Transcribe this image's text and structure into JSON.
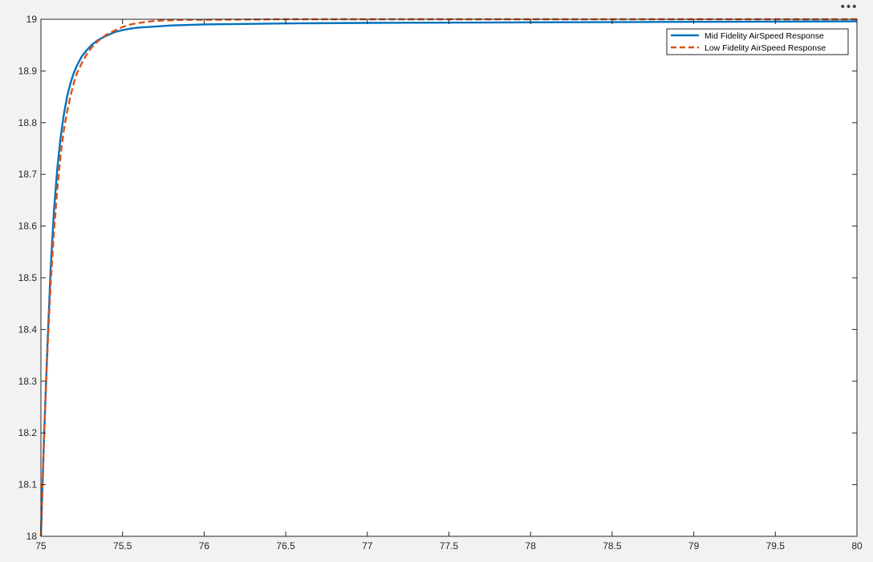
{
  "toolbar": {
    "more_icon": "ellipsis-icon",
    "more_glyph": "•••"
  },
  "colors": {
    "background": "#f2f2f2",
    "axes_background": "#ffffff",
    "axis": "#262626",
    "mid_series": "#0072bd",
    "low_series": "#d95319"
  },
  "chart_data": {
    "type": "line",
    "title": "",
    "xlabel": "",
    "ylabel": "",
    "xlim": [
      75,
      80
    ],
    "ylim": [
      18,
      19
    ],
    "xticks": [
      75,
      75.5,
      76,
      76.5,
      77,
      77.5,
      78,
      78.5,
      79,
      79.5,
      80
    ],
    "yticks": [
      18,
      18.1,
      18.2,
      18.3,
      18.4,
      18.5,
      18.6,
      18.7,
      18.8,
      18.9,
      19
    ],
    "xtick_labels": [
      "75",
      "75.5",
      "76",
      "76.5",
      "77",
      "77.5",
      "78",
      "78.5",
      "79",
      "79.5",
      "80"
    ],
    "ytick_labels": [
      "18",
      "18.1",
      "18.2",
      "18.3",
      "18.4",
      "18.5",
      "18.6",
      "18.7",
      "18.8",
      "18.9",
      "19"
    ],
    "grid": false,
    "legend_position": "top-right",
    "series": [
      {
        "name": "Mid Fidelity AirSpeed Response",
        "style": "solid",
        "color": "#0072bd",
        "x": [
          75,
          75.02,
          75.04,
          75.06,
          75.08,
          75.1,
          75.12,
          75.14,
          75.16,
          75.18,
          75.2,
          75.22,
          75.25,
          75.28,
          75.31,
          75.35,
          75.4,
          75.45,
          75.5,
          75.55,
          75.6,
          75.7,
          75.8,
          75.9,
          76,
          76.25,
          76.5,
          77,
          77.5,
          78,
          78.5,
          79,
          79.5,
          80
        ],
        "y": [
          18,
          18.2,
          18.37,
          18.52,
          18.63,
          18.71,
          18.77,
          18.815,
          18.85,
          18.875,
          18.895,
          18.91,
          18.928,
          18.94,
          18.95,
          18.96,
          18.968,
          18.975,
          18.979,
          18.982,
          18.984,
          18.986,
          18.988,
          18.989,
          18.99,
          18.991,
          18.992,
          18.993,
          18.9935,
          18.994,
          18.9945,
          18.995,
          18.9955,
          18.996
        ]
      },
      {
        "name": "Low Fidelity AirSpeed Response",
        "style": "dashed",
        "color": "#d95319",
        "x": [
          75,
          75.02,
          75.04,
          75.06,
          75.08,
          75.1,
          75.12,
          75.14,
          75.16,
          75.18,
          75.2,
          75.22,
          75.25,
          75.28,
          75.31,
          75.35,
          75.4,
          75.45,
          75.5,
          75.55,
          75.6,
          75.65,
          75.7,
          75.8,
          75.9,
          76,
          76.5,
          77,
          77.5,
          78,
          78.5,
          79,
          79.5,
          80
        ],
        "y": [
          18,
          18.2,
          18.36,
          18.49,
          18.59,
          18.67,
          18.735,
          18.785,
          18.82,
          18.85,
          18.875,
          18.895,
          18.915,
          18.932,
          18.945,
          18.958,
          18.97,
          18.978,
          18.985,
          18.99,
          18.993,
          18.995,
          18.997,
          18.998,
          18.999,
          18.999,
          19,
          19,
          19,
          19,
          19,
          19,
          19,
          19
        ]
      }
    ]
  }
}
